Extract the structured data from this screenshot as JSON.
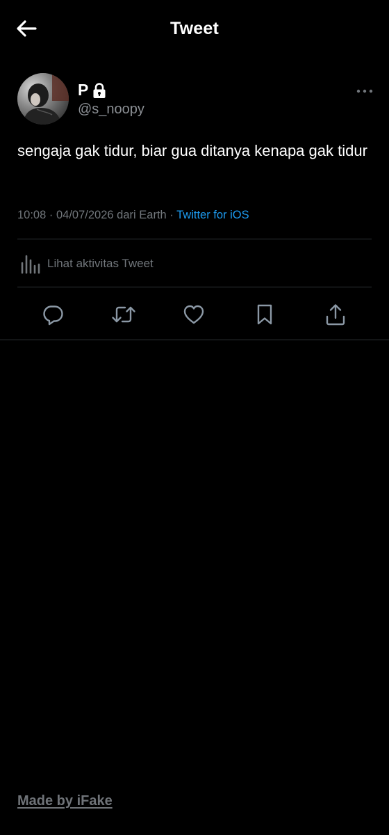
{
  "header": {
    "title": "Tweet"
  },
  "tweet": {
    "author": {
      "display_name": "P",
      "handle": "@s_noopy",
      "protected": true
    },
    "text": "sengaja gak tidur, biar gua ditanya kenapa gak tidur",
    "time": "10:08",
    "date": "04/07/2026",
    "location": "dari Earth",
    "separator": "·",
    "source": "Twitter for iOS"
  },
  "activity": {
    "label": "Lihat aktivitas Tweet"
  },
  "actions": [
    {
      "name": "reply",
      "icon": "reply-icon"
    },
    {
      "name": "retweet",
      "icon": "retweet-icon"
    },
    {
      "name": "like",
      "icon": "heart-icon"
    },
    {
      "name": "bookmark",
      "icon": "bookmark-icon"
    },
    {
      "name": "share",
      "icon": "share-icon"
    }
  ],
  "watermark": {
    "text": "Made by iFake"
  },
  "colors": {
    "background": "#000000",
    "text_primary": "#ffffff",
    "text_secondary": "#71767b",
    "accent": "#1d9bf0",
    "divider": "#2f3336",
    "icon": "#8b98a5"
  }
}
